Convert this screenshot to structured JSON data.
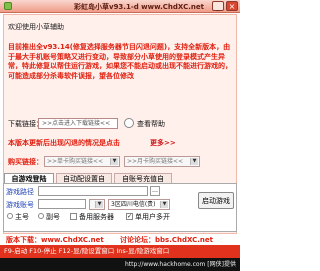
{
  "window": {
    "title": "彩虹岛小草v93.1-d www.ChdXC.net",
    "minimize_glyph": "_",
    "close_glyph": "×"
  },
  "welcome": "欢迎使用小草辅助",
  "notice": "目前推出全v93.14(修复选择服务器节目闪退问题)，支持全新版本，由于最大手机账号策略又进行变动，导致部分小草使用的登录模式产生异常，特此修复以帮住运行游戏，如果您不能启动或出现不能进行游戏的，可能造成部分杀毒软件误报，望各位修改",
  "download": {
    "label": "下载链接：",
    "link_text": ">>点击进入下载链接<<",
    "check_btn": "查看帮助"
  },
  "promo": {
    "text1": "本版本更新后出现闪退的情况是点击",
    "highlight": "更多>>",
    "text2": ""
  },
  "purchase": {
    "label": "购买链接：",
    "select1": ">>单卡购买链接<<",
    "select2": ">>月卡购买链接<<"
  },
  "tabs": [
    {
      "label": "自游戏登陆",
      "active": true
    },
    {
      "label": "自动配设置自",
      "active": false
    },
    {
      "label": "自账号充值自",
      "active": false
    }
  ],
  "form": {
    "game_path_label": "游戏路径",
    "game_path_value": "",
    "account_label": "游戏账号",
    "account_value": "",
    "server_select": "3区四川电信(贵)",
    "server_options_label": "服务器",
    "main_radio": "主号",
    "alt_radio": "副号",
    "backup_checkbox": "备用服务器",
    "single_user_checkbox": "单用户多开",
    "start_button": "启动游戏"
  },
  "footer": {
    "left": "版本下载：www.ChdXC.net",
    "right": "讨论论坛：bbs.ChdXC.net"
  },
  "bottom_bar": "F9-启动 F10-停止 F12-显/隐设置窗口 Ins-显/隐游戏窗口",
  "watermark": "http://www.hackhome.com [网侠]提供"
}
